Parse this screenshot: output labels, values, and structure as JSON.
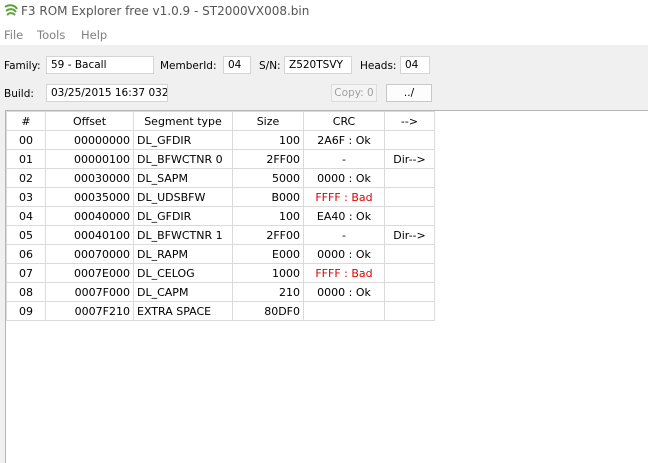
{
  "window": {
    "title": "F3 ROM Explorer free v1.0.9 - ST2000VX008.bin",
    "icon": "seagate-logo-icon"
  },
  "menu": {
    "items": [
      "File",
      "Tools",
      "Help"
    ]
  },
  "header": {
    "family_label": "Family:",
    "family_value": "59 - Bacall",
    "memberid_label": "MemberId:",
    "memberid_value": "04",
    "sn_label": "S/N:",
    "sn_value": "Z520TSVY",
    "heads_label": "Heads:",
    "heads_value": "04",
    "build_label": "Build:",
    "build_value": "03/25/2015 16:37 0325",
    "copy_button": "Copy: 0",
    "up_button": "../"
  },
  "table": {
    "columns": [
      "#",
      "Offset",
      "Segment type",
      "Size",
      "CRC",
      "-->"
    ],
    "rows": [
      {
        "num": "00",
        "offset": "00000000",
        "type": "DL_GFDIR",
        "size": "100",
        "crc": "2A6F : Ok",
        "dir": ""
      },
      {
        "num": "01",
        "offset": "00000100",
        "type": "DL_BFWCTNR 0",
        "size": "2FF00",
        "crc": "-",
        "dir": "Dir-->"
      },
      {
        "num": "02",
        "offset": "00030000",
        "type": "DL_SAPM",
        "size": "5000",
        "crc": "0000 : Ok",
        "dir": ""
      },
      {
        "num": "03",
        "offset": "00035000",
        "type": "DL_UDSBFW",
        "size": "B000",
        "crc": "FFFF : Bad",
        "dir": ""
      },
      {
        "num": "04",
        "offset": "00040000",
        "type": "DL_GFDIR",
        "size": "100",
        "crc": "EA40 : Ok",
        "dir": ""
      },
      {
        "num": "05",
        "offset": "00040100",
        "type": "DL_BFWCTNR 1",
        "size": "2FF00",
        "crc": "-",
        "dir": "Dir-->"
      },
      {
        "num": "06",
        "offset": "00070000",
        "type": "DL_RAPM",
        "size": "E000",
        "crc": "0000 : Ok",
        "dir": ""
      },
      {
        "num": "07",
        "offset": "0007E000",
        "type": "DL_CELOG",
        "size": "1000",
        "crc": "FFFF : Bad",
        "dir": ""
      },
      {
        "num": "08",
        "offset": "0007F000",
        "type": "DL_CAPM",
        "size": "210",
        "crc": "0000 : Ok",
        "dir": ""
      },
      {
        "num": "09",
        "offset": "0007F210",
        "type": "EXTRA SPACE",
        "size": "80DF0",
        "crc": "",
        "dir": ""
      }
    ]
  },
  "colors": {
    "bad": "#e00000",
    "seagate_green": "#5da33a"
  }
}
